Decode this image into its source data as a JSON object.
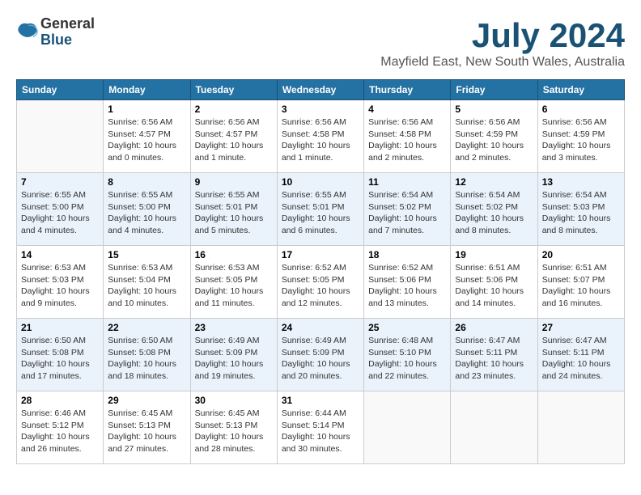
{
  "header": {
    "logo_general": "General",
    "logo_blue": "Blue",
    "month_title": "July 2024",
    "location": "Mayfield East, New South Wales, Australia"
  },
  "days_of_week": [
    "Sunday",
    "Monday",
    "Tuesday",
    "Wednesday",
    "Thursday",
    "Friday",
    "Saturday"
  ],
  "weeks": [
    [
      {
        "day": "",
        "info": ""
      },
      {
        "day": "1",
        "info": "Sunrise: 6:56 AM\nSunset: 4:57 PM\nDaylight: 10 hours\nand 0 minutes."
      },
      {
        "day": "2",
        "info": "Sunrise: 6:56 AM\nSunset: 4:57 PM\nDaylight: 10 hours\nand 1 minute."
      },
      {
        "day": "3",
        "info": "Sunrise: 6:56 AM\nSunset: 4:58 PM\nDaylight: 10 hours\nand 1 minute."
      },
      {
        "day": "4",
        "info": "Sunrise: 6:56 AM\nSunset: 4:58 PM\nDaylight: 10 hours\nand 2 minutes."
      },
      {
        "day": "5",
        "info": "Sunrise: 6:56 AM\nSunset: 4:59 PM\nDaylight: 10 hours\nand 2 minutes."
      },
      {
        "day": "6",
        "info": "Sunrise: 6:56 AM\nSunset: 4:59 PM\nDaylight: 10 hours\nand 3 minutes."
      }
    ],
    [
      {
        "day": "7",
        "info": "Sunrise: 6:55 AM\nSunset: 5:00 PM\nDaylight: 10 hours\nand 4 minutes."
      },
      {
        "day": "8",
        "info": "Sunrise: 6:55 AM\nSunset: 5:00 PM\nDaylight: 10 hours\nand 4 minutes."
      },
      {
        "day": "9",
        "info": "Sunrise: 6:55 AM\nSunset: 5:01 PM\nDaylight: 10 hours\nand 5 minutes."
      },
      {
        "day": "10",
        "info": "Sunrise: 6:55 AM\nSunset: 5:01 PM\nDaylight: 10 hours\nand 6 minutes."
      },
      {
        "day": "11",
        "info": "Sunrise: 6:54 AM\nSunset: 5:02 PM\nDaylight: 10 hours\nand 7 minutes."
      },
      {
        "day": "12",
        "info": "Sunrise: 6:54 AM\nSunset: 5:02 PM\nDaylight: 10 hours\nand 8 minutes."
      },
      {
        "day": "13",
        "info": "Sunrise: 6:54 AM\nSunset: 5:03 PM\nDaylight: 10 hours\nand 8 minutes."
      }
    ],
    [
      {
        "day": "14",
        "info": "Sunrise: 6:53 AM\nSunset: 5:03 PM\nDaylight: 10 hours\nand 9 minutes."
      },
      {
        "day": "15",
        "info": "Sunrise: 6:53 AM\nSunset: 5:04 PM\nDaylight: 10 hours\nand 10 minutes."
      },
      {
        "day": "16",
        "info": "Sunrise: 6:53 AM\nSunset: 5:05 PM\nDaylight: 10 hours\nand 11 minutes."
      },
      {
        "day": "17",
        "info": "Sunrise: 6:52 AM\nSunset: 5:05 PM\nDaylight: 10 hours\nand 12 minutes."
      },
      {
        "day": "18",
        "info": "Sunrise: 6:52 AM\nSunset: 5:06 PM\nDaylight: 10 hours\nand 13 minutes."
      },
      {
        "day": "19",
        "info": "Sunrise: 6:51 AM\nSunset: 5:06 PM\nDaylight: 10 hours\nand 14 minutes."
      },
      {
        "day": "20",
        "info": "Sunrise: 6:51 AM\nSunset: 5:07 PM\nDaylight: 10 hours\nand 16 minutes."
      }
    ],
    [
      {
        "day": "21",
        "info": "Sunrise: 6:50 AM\nSunset: 5:08 PM\nDaylight: 10 hours\nand 17 minutes."
      },
      {
        "day": "22",
        "info": "Sunrise: 6:50 AM\nSunset: 5:08 PM\nDaylight: 10 hours\nand 18 minutes."
      },
      {
        "day": "23",
        "info": "Sunrise: 6:49 AM\nSunset: 5:09 PM\nDaylight: 10 hours\nand 19 minutes."
      },
      {
        "day": "24",
        "info": "Sunrise: 6:49 AM\nSunset: 5:09 PM\nDaylight: 10 hours\nand 20 minutes."
      },
      {
        "day": "25",
        "info": "Sunrise: 6:48 AM\nSunset: 5:10 PM\nDaylight: 10 hours\nand 22 minutes."
      },
      {
        "day": "26",
        "info": "Sunrise: 6:47 AM\nSunset: 5:11 PM\nDaylight: 10 hours\nand 23 minutes."
      },
      {
        "day": "27",
        "info": "Sunrise: 6:47 AM\nSunset: 5:11 PM\nDaylight: 10 hours\nand 24 minutes."
      }
    ],
    [
      {
        "day": "28",
        "info": "Sunrise: 6:46 AM\nSunset: 5:12 PM\nDaylight: 10 hours\nand 26 minutes."
      },
      {
        "day": "29",
        "info": "Sunrise: 6:45 AM\nSunset: 5:13 PM\nDaylight: 10 hours\nand 27 minutes."
      },
      {
        "day": "30",
        "info": "Sunrise: 6:45 AM\nSunset: 5:13 PM\nDaylight: 10 hours\nand 28 minutes."
      },
      {
        "day": "31",
        "info": "Sunrise: 6:44 AM\nSunset: 5:14 PM\nDaylight: 10 hours\nand 30 minutes."
      },
      {
        "day": "",
        "info": ""
      },
      {
        "day": "",
        "info": ""
      },
      {
        "day": "",
        "info": ""
      }
    ]
  ]
}
